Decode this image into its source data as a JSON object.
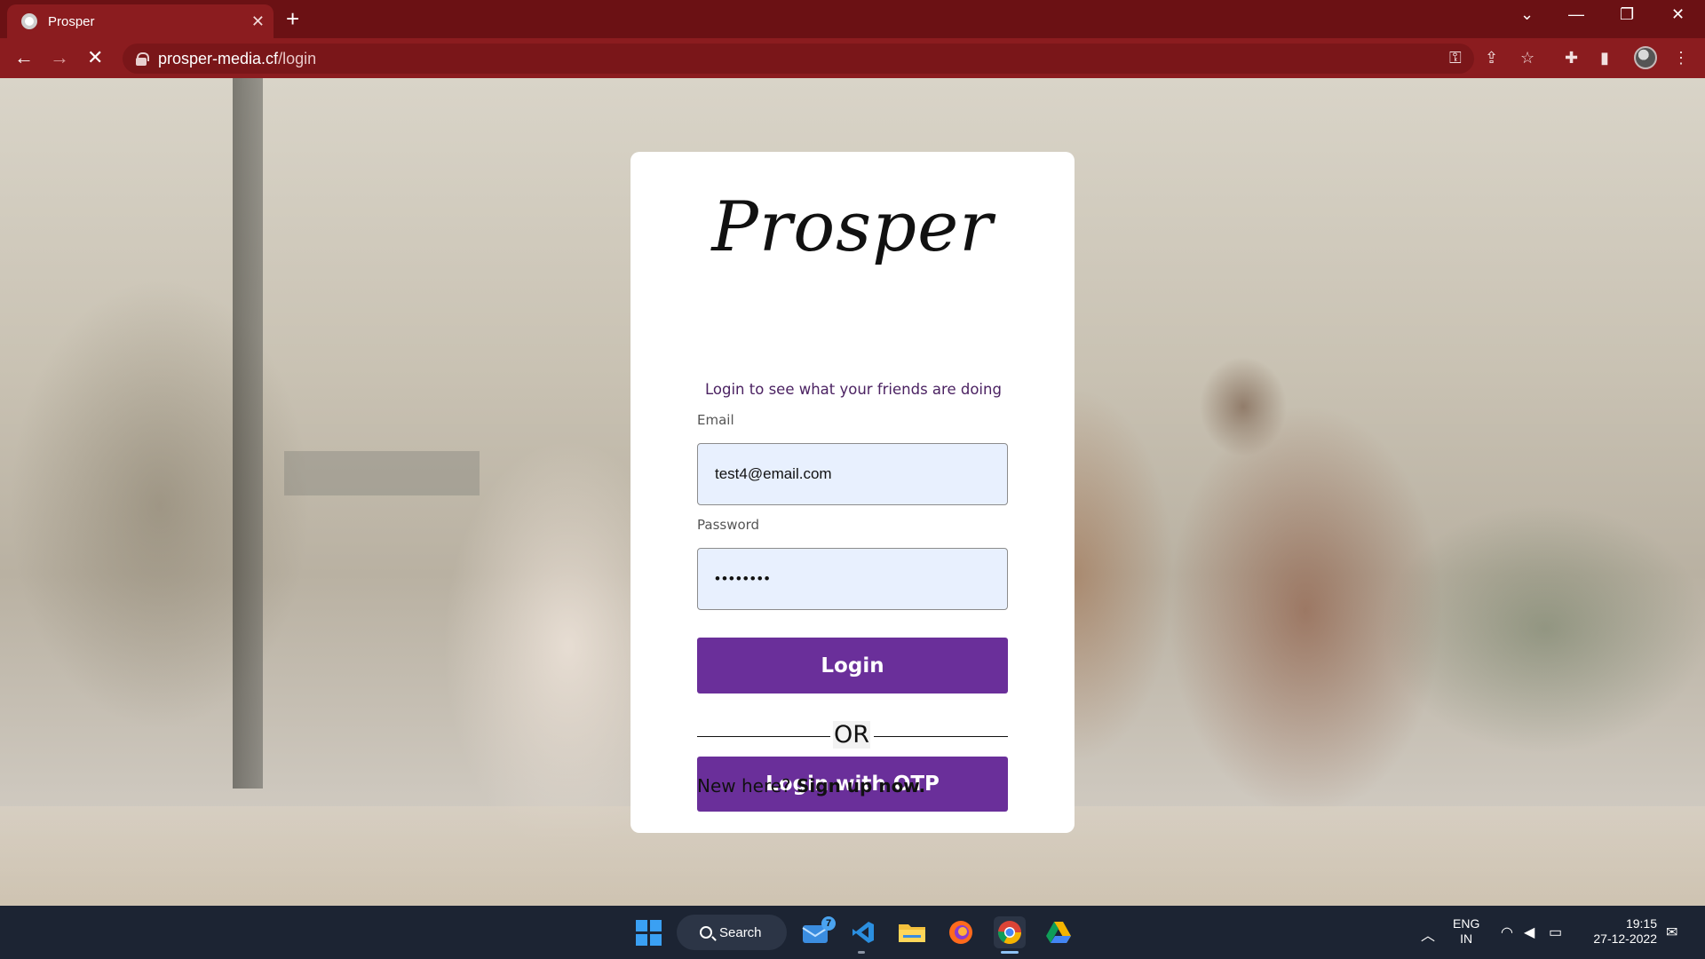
{
  "browser": {
    "tab_title": "Prosper",
    "url_host": "prosper-media.cf",
    "url_path": "/login"
  },
  "card": {
    "logo": "Prosper",
    "subtitle": "Login to see what your friends are doing",
    "email_label": "Email",
    "email_value": "test4@email.com",
    "password_label": "Password",
    "password_value": "••••••••",
    "login_button": "Login",
    "divider_text": "OR",
    "otp_button": "Login with OTP",
    "signup_prompt": "New here?",
    "signup_link": "Sign up now."
  },
  "taskbar": {
    "search_label": "Search",
    "mail_badge": "7",
    "language": "ENG",
    "region": "IN",
    "time": "19:15",
    "date": "27-12-2022"
  },
  "colors": {
    "tabbar": "#6b1114",
    "toolbar": "#8b1c1f",
    "button": "#6a2f9a",
    "field_bg": "#e8f0fe",
    "taskbar": "#1c2433"
  },
  "icons": [
    "back-icon",
    "forward-icon",
    "stop-loading-icon",
    "lock-icon",
    "key-icon",
    "share-icon",
    "star-icon",
    "extensions-icon",
    "side-panel-icon",
    "menu-icon",
    "windows-start-icon",
    "search-icon",
    "mail-icon",
    "vscode-icon",
    "file-explorer-icon",
    "firefox-icon",
    "chrome-icon",
    "drive-icon",
    "chevron-up-icon",
    "wifi-icon",
    "volume-icon",
    "battery-icon",
    "notification-icon"
  ]
}
